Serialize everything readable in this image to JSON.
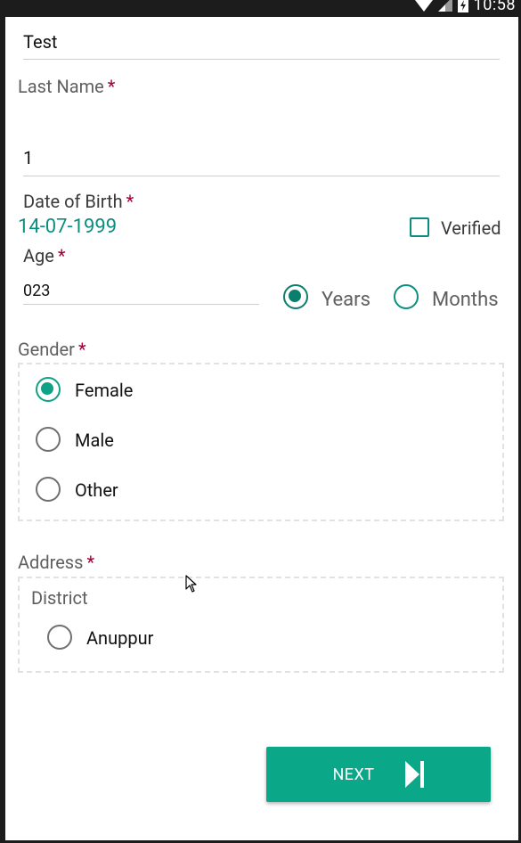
{
  "status_bar": {
    "time": "10:58"
  },
  "form": {
    "first_name_value": "Test",
    "last_name_label": "Last Name",
    "last_name_value": "1",
    "required_mark": "*",
    "dob_label": "Date of Birth",
    "dob_value": "14-07-1999",
    "verified_label": "Verified",
    "age_label": "Age",
    "age_value": "023",
    "age_units": [
      "Years",
      "Months"
    ],
    "age_unit_selected": "Years",
    "gender_label": "Gender",
    "gender_options": [
      "Female",
      "Male",
      "Other"
    ],
    "gender_selected": "Female",
    "address_label": "Address",
    "district_label": "District",
    "district_options": [
      "Anuppur"
    ],
    "next_label": "NEXT"
  },
  "colors": {
    "accent": "#11a186",
    "button": "#0aa788",
    "date_text": "#0b8e80",
    "required": "#a4003a"
  },
  "icons": [
    "wifi-icon",
    "signal-icon",
    "battery-charging-icon",
    "skip-next-icon",
    "mouse-cursor-icon"
  ]
}
